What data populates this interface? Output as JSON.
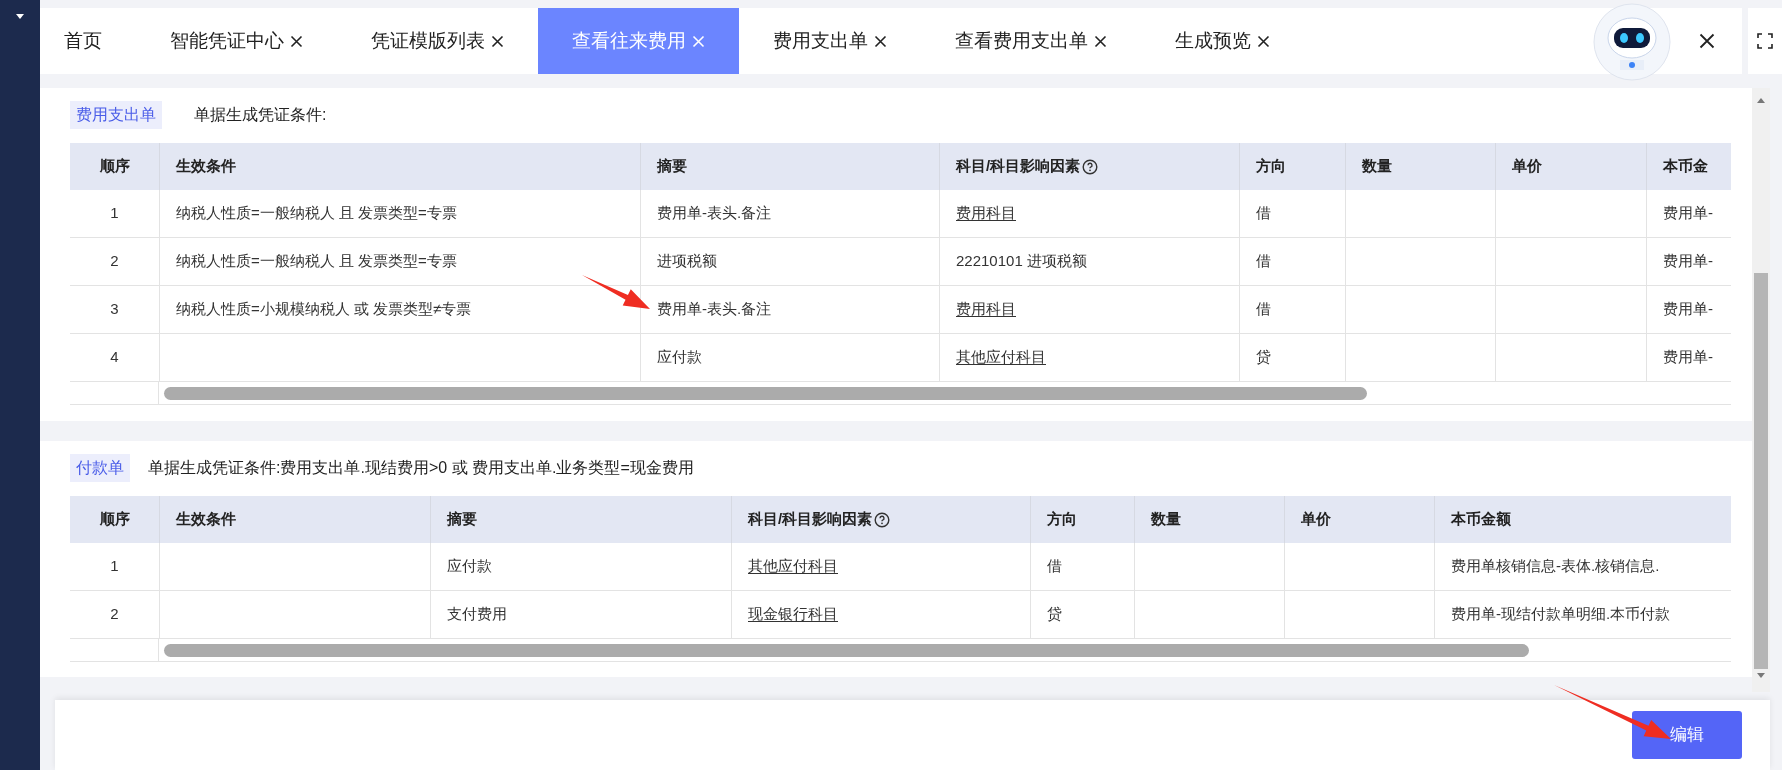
{
  "tabs": [
    {
      "label": "首页",
      "closable": false,
      "selected": false
    },
    {
      "label": "智能凭证中心",
      "closable": true,
      "selected": false
    },
    {
      "label": "凭证模版列表",
      "closable": true,
      "selected": false
    },
    {
      "label": "查看往来费用",
      "closable": true,
      "selected": true
    },
    {
      "label": "费用支出单",
      "closable": true,
      "selected": false
    },
    {
      "label": "查看费用支出单",
      "closable": true,
      "selected": false
    },
    {
      "label": "生成预览",
      "closable": true,
      "selected": false
    }
  ],
  "sections": [
    {
      "badge": "费用支出单",
      "condition": "单据生成凭证条件:",
      "columns": [
        {
          "label": "顺序",
          "help": false
        },
        {
          "label": "生效条件",
          "help": false
        },
        {
          "label": "摘要",
          "help": false
        },
        {
          "label": "科目/科目影响因素",
          "help": true
        },
        {
          "label": "方向",
          "help": false
        },
        {
          "label": "数量",
          "help": false
        },
        {
          "label": "单价",
          "help": false
        },
        {
          "label": "本币金",
          "help": false
        }
      ],
      "rows": [
        {
          "order": "1",
          "condition": "纳税人性质=一般纳税人 且 发票类型=专票",
          "summary": "费用单-表头.备注",
          "account": "费用科目",
          "account_link": true,
          "direction": "借",
          "amount": "费用单-"
        },
        {
          "order": "2",
          "condition": "纳税人性质=一般纳税人 且 发票类型=专票",
          "summary": "进项税额",
          "account": "22210101 进项税额",
          "account_link": false,
          "direction": "借",
          "amount": "费用单-"
        },
        {
          "order": "3",
          "condition": "纳税人性质=小规模纳税人 或 发票类型≠专票",
          "summary": "费用单-表头.备注",
          "account": "费用科目",
          "account_link": true,
          "direction": "借",
          "amount": "费用单-"
        },
        {
          "order": "4",
          "summary": "应付款",
          "account": "其他应付科目",
          "account_link": true,
          "direction": "贷",
          "amount": "费用单-"
        }
      ]
    },
    {
      "badge": "付款单",
      "condition": "单据生成凭证条件:费用支出单.现结费用>0 或 费用支出单.业务类型=现金费用",
      "columns": [
        {
          "label": "顺序",
          "help": false
        },
        {
          "label": "生效条件",
          "help": false
        },
        {
          "label": "摘要",
          "help": false
        },
        {
          "label": "科目/科目影响因素",
          "help": true
        },
        {
          "label": "方向",
          "help": false
        },
        {
          "label": "数量",
          "help": false
        },
        {
          "label": "单价",
          "help": false
        },
        {
          "label": "本币金额",
          "help": false
        }
      ],
      "rows": [
        {
          "order": "1",
          "summary": "应付款",
          "account": "其他应付科目",
          "account_link": true,
          "direction": "借",
          "amount": "费用单核销信息-表体.核销信息."
        },
        {
          "order": "2",
          "summary": "支付费用",
          "account": "现金银行科目",
          "account_link": true,
          "direction": "贷",
          "amount": "费用单-现结付款单明细.本币付款"
        }
      ]
    }
  ],
  "footer": {
    "edit_button": "编辑"
  }
}
